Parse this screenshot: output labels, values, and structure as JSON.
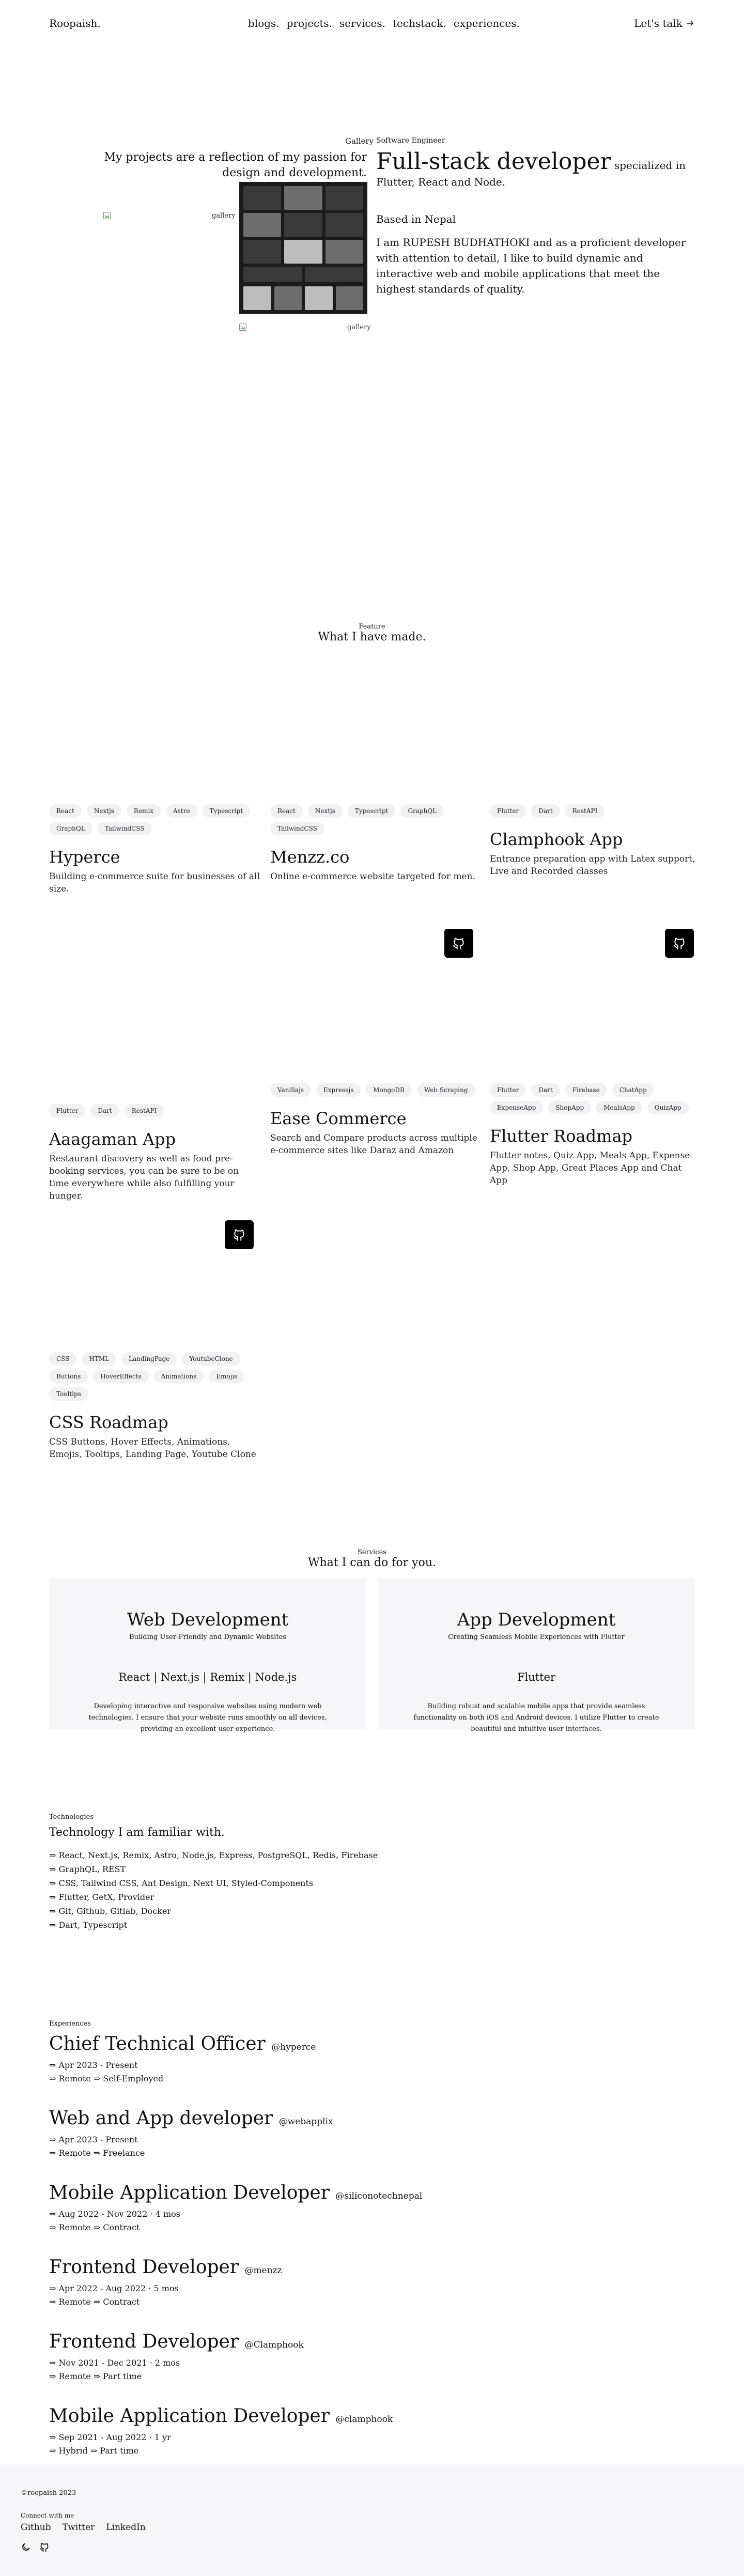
{
  "nav": {
    "brand": "Roopaish.",
    "links": [
      "blogs.",
      "projects.",
      "services.",
      "techstack.",
      "experiences."
    ],
    "cta": "Let's talk"
  },
  "hero": {
    "gallery_label": "Gallery",
    "tagline": "My projects are a reflection of my passion for design and development.",
    "img_alt": "gallery",
    "eyebrow": "Software Engineer",
    "title_big": "Full-stack developer",
    "title_rest": "specialized in Flutter, React and Node.",
    "based": "Based in Nepal",
    "bio_pre": "I am",
    "bio_name": "RUPESH BUDHATHOKI",
    "bio_post": "and as a proficient developer with attention to detail, I like to build dynamic and interactive web and mobile applications that meet the highest standards of quality."
  },
  "featured": {
    "eyebrow": "Feature",
    "title": "What I have made."
  },
  "projects": [
    {
      "name": "Hyperce",
      "desc": "Building e-commerce suite for businesses of all size.",
      "tags": [
        "React",
        "Nextjs",
        "Remix",
        "Astro",
        "Typescript",
        "GraphQL",
        "TailwindCSS"
      ],
      "github": false
    },
    {
      "name": "Menzz.co",
      "desc": "Online e-commerce website targeted for men.",
      "tags": [
        "React",
        "Nextjs",
        "Typescript",
        "GraphQL",
        "TailwindCSS"
      ],
      "github": false
    },
    {
      "name": "Clamphook App",
      "desc": "Entrance preparation app with Latex support, Live and Recorded classes",
      "tags": [
        "Flutter",
        "Dart",
        "RestAPI"
      ],
      "github": true
    },
    {
      "name": "Aaagaman App",
      "desc": "Restaurant discovery as well as food pre-booking services, you can be sure to be on time everywhere while also fulfilling your hunger.",
      "tags": [
        "Flutter",
        "Dart",
        "RestAPI"
      ],
      "github": true
    },
    {
      "name": "Ease Commerce",
      "desc": "Search and Compare products across multiple e-commerce sites like Daraz and Amazon",
      "tags": [
        "Vanillajs",
        "Expressjs",
        "MongoDB",
        "Web Scraping"
      ],
      "github": false
    },
    {
      "name": "Flutter Roadmap",
      "desc": "Flutter notes, Quiz App, Meals App, Expense App, Shop App, Great Places App and Chat App",
      "tags": [
        "Flutter",
        "Dart",
        "Firebase",
        "ChatApp",
        "ExpenseApp",
        "ShopApp",
        "MealsApp",
        "QuizApp"
      ],
      "github": false
    },
    {
      "name": "CSS Roadmap",
      "desc": "CSS Buttons, Hover Effects, Animations, Emojis, Tooltips, Landing Page, Youtube Clone",
      "tags": [
        "CSS",
        "HTML",
        "LandingPage",
        "YoutubeClone",
        "Buttons",
        "HoverEffects",
        "Animations",
        "Emojis",
        "Tooltips"
      ],
      "github": false
    }
  ],
  "services": {
    "eyebrow": "Services",
    "title": "What I can do for you.",
    "items": [
      {
        "title": "Web Development",
        "sub": "Building User-Friendly and Dynamic Websites",
        "stack": "React | Next.js | Remix | Node.js",
        "desc": "Developing interactive and responsive websites using modern web technologies. I ensure that your website runs smoothly on all devices, providing an excellent user experience."
      },
      {
        "title": "App Development",
        "sub": "Creating Seamless Mobile Experiences with Flutter",
        "stack": "Flutter",
        "desc": "Building robust and scalable mobile apps that provide seamless functionality on both iOS and Android devices. I utilize Flutter to create beautiful and intuitive user interfaces."
      }
    ]
  },
  "tech": {
    "eyebrow": "Technologies",
    "title": "Technology I am familiar with.",
    "items": [
      "⇒ React, Next.js, Remix, Astro, Node.js, Express, PostgreSQL, Redis, Firebase",
      "⇒ GraphQL, REST",
      "⇒ CSS, Tailwind CSS, Ant Design, Next UI, Styled-Components",
      "⇒ Flutter, GetX, Provider",
      "⇒ Git, Github, Gitlab, Docker",
      "⇒ Dart, Typescript"
    ]
  },
  "experience": {
    "eyebrow": "Experiences",
    "jobs": [
      {
        "title": "Chief Technical Officer",
        "at": "@hyperce",
        "period": "⇒ Apr 2023 - Present",
        "type": "⇒ Remote ⇒ Self-Employed"
      },
      {
        "title": "Web and App developer",
        "at": "@webapplix",
        "period": "⇒ Apr 2023 - Present",
        "type": "⇒ Remote ⇒ Freelance"
      },
      {
        "title": "Mobile Application Developer",
        "at": "@siliconotechnepal",
        "period": "⇒ Aug 2022 - Nov 2022 · 4 mos",
        "type": "⇒ Remote ⇒ Contract"
      },
      {
        "title": "Frontend Developer",
        "at": "@menzz",
        "period": "⇒ Apr 2022 - Aug 2022 · 5 mos",
        "type": "⇒ Remote ⇒ Contract"
      },
      {
        "title": "Frontend Developer",
        "at": "@Clamphook",
        "period": "⇒ Nov 2021 - Dec 2021 · 2 mos",
        "type": "⇒ Remote ⇒ Part time"
      },
      {
        "title": "Mobile Application Developer",
        "at": "@clamphook",
        "period": "⇒ Sep 2021 - Aug 2022 · 1 yr",
        "type": "⇒ Hybrid ⇒ Part time"
      }
    ]
  },
  "footer": {
    "copyright": "©roopaish 2023",
    "connect": "Connect with me",
    "links": [
      "Github",
      "Twitter",
      "LinkedIn"
    ]
  }
}
